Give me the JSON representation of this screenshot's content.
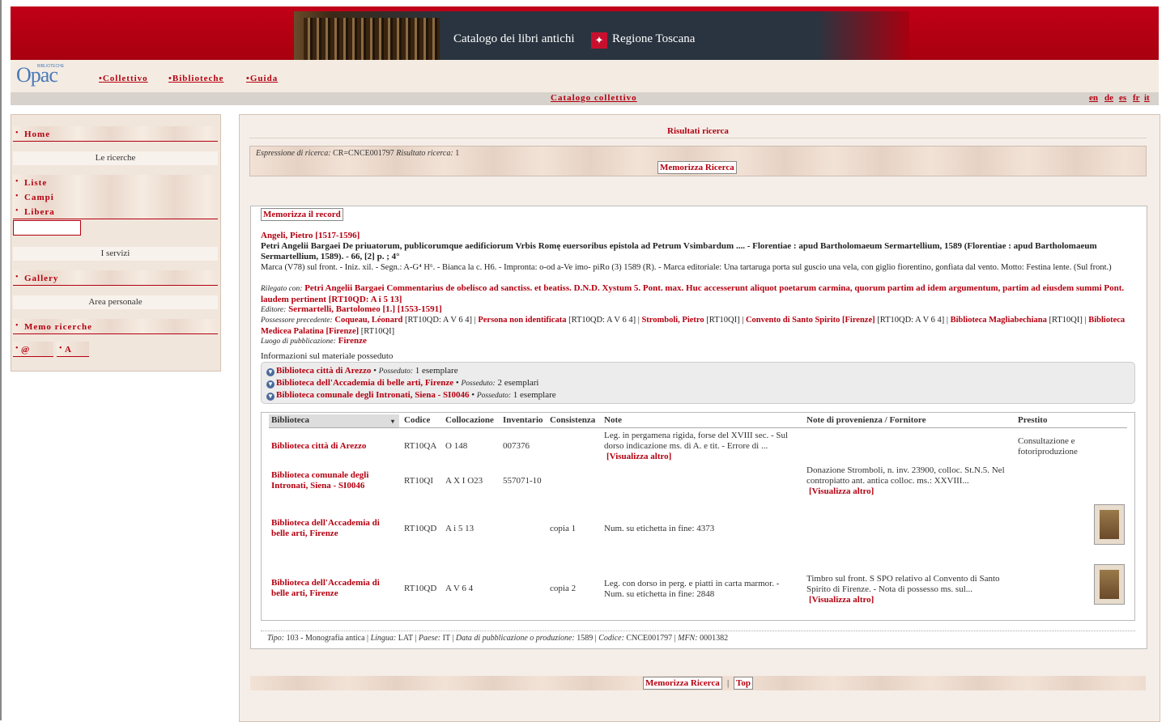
{
  "banner": {
    "title": "Catalogo dei libri antichi",
    "region": "Regione Toscana"
  },
  "logo": {
    "main": "Opac",
    "sub": "BIBLIOTECHE"
  },
  "nav": [
    "Collettivo",
    "Biblioteche",
    "Guida"
  ],
  "catbar": {
    "label": "Catalogo collettivo",
    "langs": [
      "en",
      "de",
      "es",
      "fr",
      "it"
    ]
  },
  "sidebar": {
    "home": "Home",
    "ricerche_head": "Le ricerche",
    "liste": "Liste",
    "campi": "Campi",
    "libera": "Libera",
    "servizi_head": "I servizi",
    "gallery": "Gallery",
    "personale_head": "Area personale",
    "memo": "Memo ricerche",
    "at": "@",
    "a": "A"
  },
  "results": {
    "title": "Risultati ricerca",
    "expr_label": "Espressione di ricerca:",
    "expr_value": "CR=CNCE001797",
    "count_label": "Risultato ricerca:",
    "count_value": "1",
    "memorizza_ricerca": "Memorizza Ricerca"
  },
  "record": {
    "memorizza_record": "Memorizza il record",
    "author": "Angeli, Pietro [1517-1596]",
    "title": "Petri Angelii Bargaei De priuatorum, publicorumque aedificiorum Vrbis Romę euersoribus epistola ad Petrum Vsimbardum .... - Florentiae : apud Bartholomaeum Sermartellium, 1589 (Florentiae : apud Bartholomaeum Sermartellium, 1589). - 66, [2] p. ; 4°",
    "notes": "Marca (V78) sul front. - Iniz. xil. - Segn.: A-G⁴ H⁶. - Bianca la c. H6. - Impronta: o-od a-Ve imo- piRo (3) 1589 (R). - Marca editoriale: Una tartaruga porta sul guscio una vela, con giglio fiorentino, gonfiata dal vento. Motto: Festina lente. (Sul front.)",
    "legato_label": "Rilegato con:",
    "legato_value": "Petri Angelii Bargaei Commentarius de obelisco ad sanctiss. et beatiss. D.N.D. Xystum 5. Pont. max. Huc accesserunt aliquot poetarum carmina, quorum partim ad idem argumentum, partim ad eiusdem summi Pont. laudem pertinent [RT10QD: A i 5 13]",
    "editore_label": "Editore:",
    "editore_value": "Sermartelli, Bartolomeo [1.] [1553-1591]",
    "possessore_label": "Possessore precedente:",
    "possessori": [
      {
        "name": "Coqueau, Léonard",
        "code": "[RT10QD: A V 6 4]"
      },
      {
        "name": "Persona non identificata",
        "code": "[RT10QD: A V 6 4]"
      },
      {
        "name": "Stromboli, Pietro",
        "code": "[RT10QI]"
      },
      {
        "name": "Convento di Santo Spirito [Firenze]",
        "code": "[RT10QD: A V 6 4]"
      },
      {
        "name": "Biblioteca Magliabechiana",
        "code": "[RT10QI]"
      },
      {
        "name": "Biblioteca Medicea Palatina [Firenze]",
        "code": "[RT10QI]"
      }
    ],
    "luogo_label": "Luogo di pubblicazione:",
    "luogo_value": "Firenze",
    "info_head": "Informazioni sul materiale posseduto",
    "posseduto_label": "Posseduto:",
    "holdings": [
      {
        "lib": "Biblioteca città di Arezzo",
        "qty": "1 esemplare"
      },
      {
        "lib": "Biblioteca dell'Accademia di belle arti, Firenze",
        "qty": "2 esemplari"
      },
      {
        "lib": "Biblioteca comunale degli Intronati, Siena - SI0046",
        "qty": "1 esemplare"
      }
    ]
  },
  "table": {
    "headers": [
      "Biblioteca",
      "Codice",
      "Collocazione",
      "Inventario",
      "Consistenza",
      "Note",
      "Note di provenienza / Fornitore",
      "Prestito"
    ],
    "more": "[Visualizza altro]",
    "rows": [
      {
        "lib1": "Biblioteca città di Arezzo",
        "lib2": "",
        "codice": "RT10QA",
        "colloc": "O 148",
        "inv": "007376",
        "cons": "",
        "note1": "Leg. in pergamena rigida, forse del XVIII sec. - Sul",
        "note2": "dorso indicazione ms. di A. e tit. - Errore di ...",
        "prov1": "",
        "prov2": "",
        "prestito1": "Consultazione e",
        "prestito2": "fotoriproduzione"
      },
      {
        "lib1": "Biblioteca comunale degli",
        "lib2": "Intronati, Siena - SI0046",
        "codice": "RT10QI",
        "colloc": "A X I O23",
        "inv": "557071-10",
        "cons": "",
        "note1": "",
        "note2": "",
        "prov1": "Donazione Stromboli, n. inv. 23900, colloc. St.N.5. Nel",
        "prov2": "contropiatto ant. antica colloc. ms.: XXVIII...",
        "prestito1": "",
        "prestito2": ""
      },
      {
        "lib1": "Biblioteca dell'Accademia di",
        "lib2": "belle arti, Firenze",
        "codice": "RT10QD",
        "colloc": "A i 5 13",
        "inv": "",
        "cons": "copia 1",
        "note1": "Num. su etichetta in fine: 4373",
        "note2": "",
        "prov1": "",
        "prov2": "",
        "prestito1": "",
        "prestito2": ""
      },
      {
        "lib1": "Biblioteca dell'Accademia di",
        "lib2": "belle arti, Firenze",
        "codice": "RT10QD",
        "colloc": "A V 6 4",
        "inv": "",
        "cons": "copia 2",
        "note1": "Leg. con dorso in perg. e piatti in carta marmor. -",
        "note2": "Num. su etichetta in fine: 2848",
        "prov1": "Timbro sul front. S SPO relativo al Convento di Santo",
        "prov2": "Spirito di Firenze. - Nota di possesso ms. sul...",
        "prestito1": "",
        "prestito2": ""
      }
    ]
  },
  "footer": {
    "tipo_label": "Tipo:",
    "tipo": "103 - Monografia antica",
    "lingua_label": "Lingua:",
    "lingua": "LAT",
    "paese_label": "Paese:",
    "paese": "IT",
    "data_label": "Data di pubblicazione o produzione:",
    "data": "1589",
    "codice_label": "Codice:",
    "codice": "CNCE001797",
    "mfn_label": "MFN:",
    "mfn": "0001382"
  },
  "bottom": {
    "memorizza": "Memorizza Ricerca",
    "sep": "|",
    "top": "Top"
  }
}
